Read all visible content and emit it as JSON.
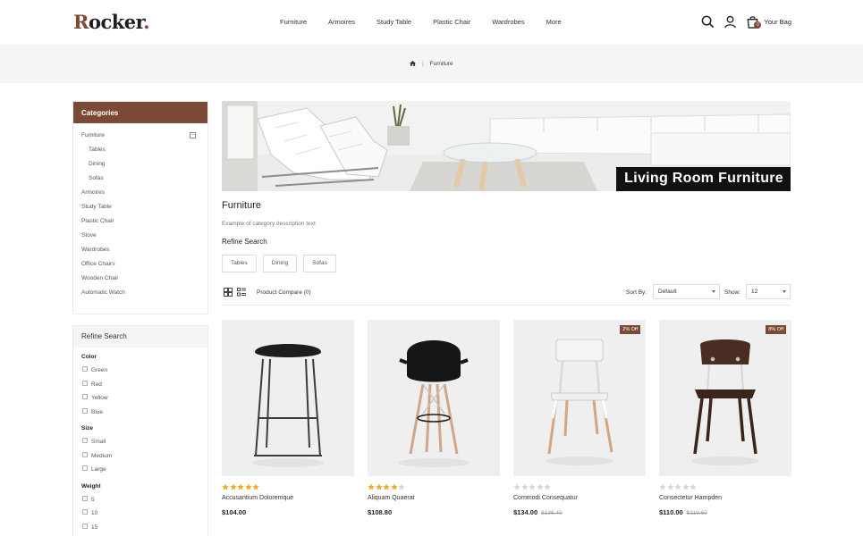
{
  "brand": {
    "logo_cap": "R",
    "logo_rest": "ocker",
    "logo_dot": "."
  },
  "nav": [
    "Furniture",
    "Armoires",
    "Study Table",
    "Plastic Chair",
    "Wardrobes",
    "More"
  ],
  "header": {
    "bag_label": "Your Bag",
    "bag_count": "0"
  },
  "breadcrumb": {
    "current": "Furniture"
  },
  "sidebar": {
    "categories_title": "Categories",
    "categories": [
      {
        "label": "Furniture",
        "sub": false
      },
      {
        "label": "Tables",
        "sub": true
      },
      {
        "label": "Dining",
        "sub": true
      },
      {
        "label": "Sofas",
        "sub": true
      },
      {
        "label": "Armoires",
        "sub": false
      },
      {
        "label": "Study Table",
        "sub": false
      },
      {
        "label": "Plastic Chair",
        "sub": false
      },
      {
        "label": "Stove",
        "sub": false
      },
      {
        "label": "Wardrobes",
        "sub": false
      },
      {
        "label": "Office Chairs",
        "sub": false
      },
      {
        "label": "Wooden Chair",
        "sub": false
      },
      {
        "label": "Automatic Watch",
        "sub": false
      }
    ],
    "refine_title": "Refine Search",
    "filters": {
      "color_title": "Color",
      "colors": [
        "Green",
        "Red",
        "Yellow",
        "Blue"
      ],
      "size_title": "Size",
      "sizes": [
        "Small",
        "Medium",
        "Large"
      ],
      "weight_title": "Weight",
      "weights": [
        "5",
        "10",
        "15"
      ]
    }
  },
  "banner": {
    "label": "Living Room Furniture"
  },
  "main": {
    "title": "Furniture",
    "description": "Example of category description text",
    "refine_title": "Refine Search",
    "refine_tags": [
      "Tables",
      "Dining",
      "Sofas"
    ],
    "compare_label": "Product Compare (0)",
    "sort_label": "Sort By:",
    "sort_value": "Default",
    "show_label": "Show:",
    "show_value": "12"
  },
  "products": [
    {
      "name": "Accusantium Doloremque",
      "price": "$104.00",
      "old_price": "",
      "rating": 5,
      "badge": ""
    },
    {
      "name": "Aliquam Quaerat",
      "price": "$108.80",
      "old_price": "",
      "rating": 4,
      "badge": ""
    },
    {
      "name": "Commodi Consequatur",
      "price": "$134.00",
      "old_price": "$136.40",
      "rating": 0,
      "badge": "2% Off"
    },
    {
      "name": "Consectetur Hampden",
      "price": "$110.00",
      "old_price": "$119.60",
      "rating": 0,
      "badge": "8% Off"
    }
  ],
  "colors": {
    "accent": "#7a4a36",
    "star_on": "#f5a623",
    "star_off": "#d6d6d6"
  }
}
